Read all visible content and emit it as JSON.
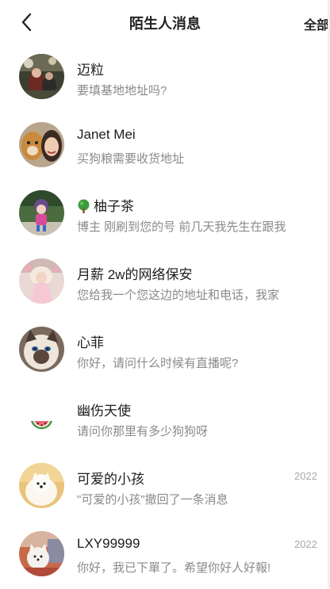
{
  "header": {
    "title": "陌生人消息",
    "right_label": "全部"
  },
  "conversations": [
    {
      "name": "迈粒",
      "preview": "要填基地地址吗?",
      "time": ""
    },
    {
      "name": "Janet Mei",
      "preview": "买狗粮需要收货地址",
      "time": ""
    },
    {
      "name": "柚子茶",
      "name_prefix_icon": "tree-emoji",
      "preview": "博主 刚刷到您的号 前几天我先生在跟我",
      "time": ""
    },
    {
      "name": "月薪 2w的网络保安",
      "preview": "您给我一个您这边的地址和电话，我家",
      "time": ""
    },
    {
      "name": "心菲",
      "preview": "你好，请问什么时候有直播呢?",
      "time": ""
    },
    {
      "name": "幽伤天使",
      "preview": "请问你那里有多少狗狗呀",
      "time": ""
    },
    {
      "name": "可爱的小孩",
      "preview": "\"可爱的小孩\"撤回了一条消息",
      "time": "2022"
    },
    {
      "name": "LXY99999",
      "preview": "你好，我已下單了。希望你好人好報!",
      "time": "2022"
    }
  ],
  "icons": {
    "back": "chevron-left-icon",
    "tree": "tree-emoji",
    "watermelon": "watermelon-slice"
  }
}
